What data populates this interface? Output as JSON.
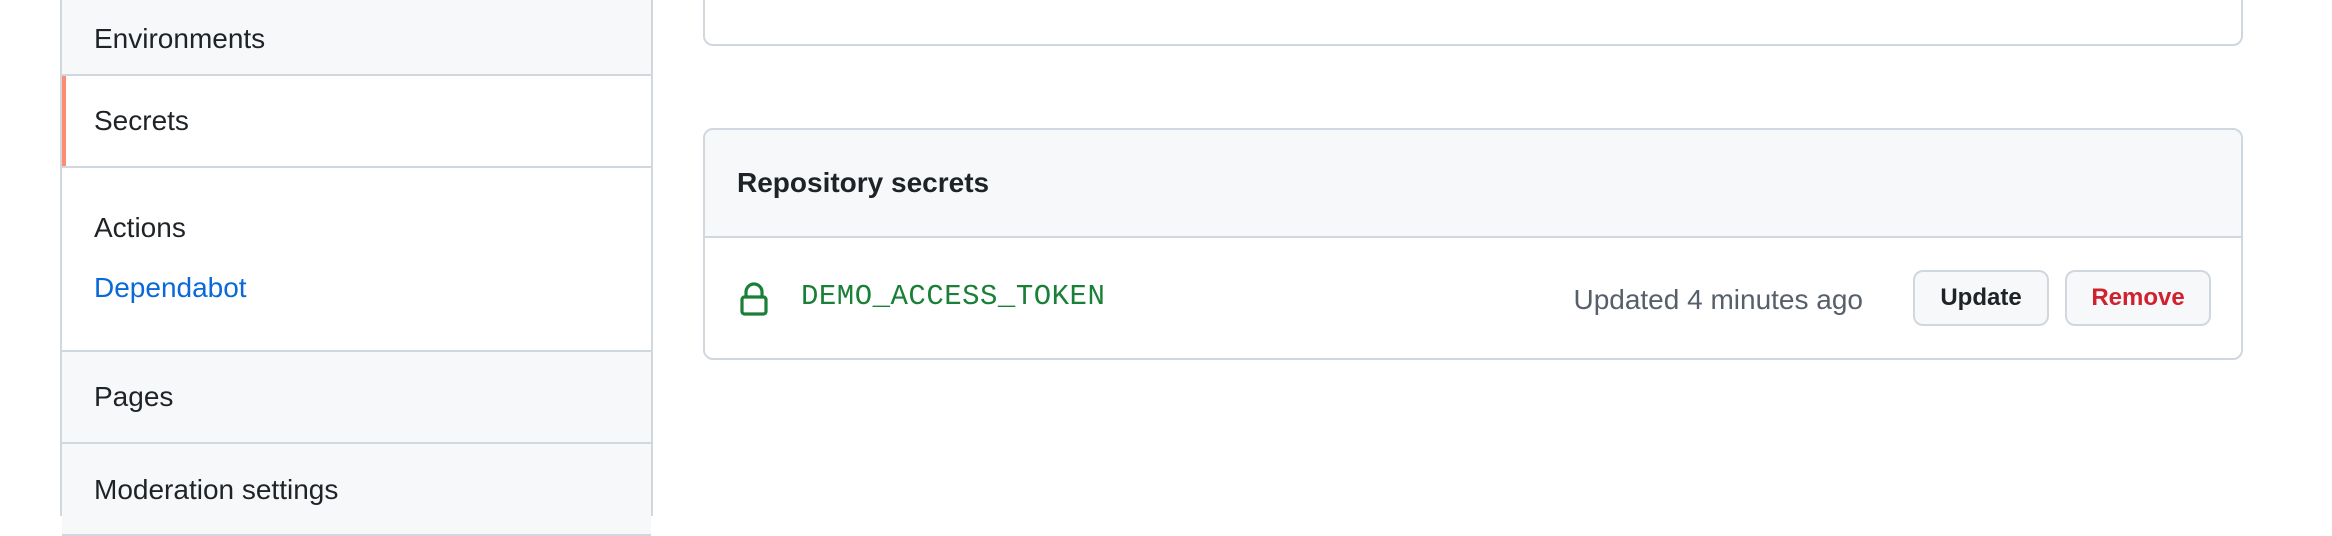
{
  "sidebar": {
    "environments_label": "Environments",
    "secrets_label": "Secrets",
    "group_title": "Actions",
    "dependabot_label": "Dependabot",
    "pages_label": "Pages",
    "moderation_label": "Moderation settings",
    "active_color": "#fd8c73",
    "link_color": "#0969da"
  },
  "secrets_section": {
    "title": "Repository secrets",
    "items": [
      {
        "icon": "lock-icon",
        "name": "DEMO_ACCESS_TOKEN",
        "updated": "Updated 4 minutes ago",
        "update_label": "Update",
        "remove_label": "Remove"
      }
    ],
    "name_color": "#1a7f37",
    "remove_color": "#cf222e"
  }
}
